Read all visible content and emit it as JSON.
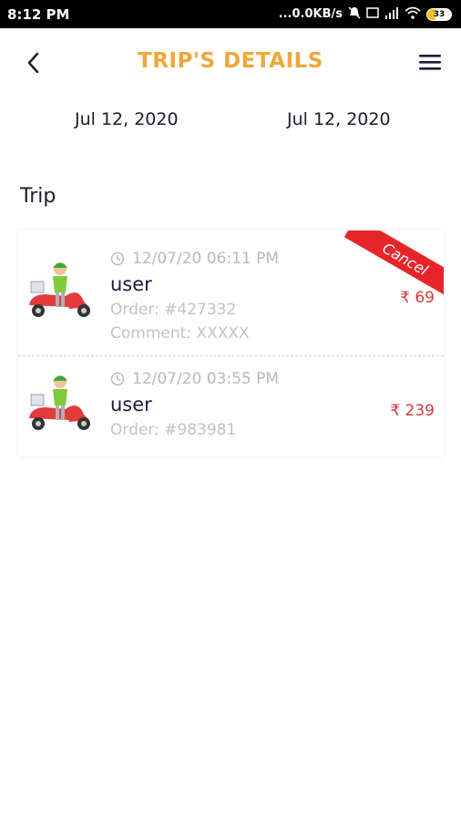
{
  "status_bar": {
    "time": "8:12 PM",
    "network_speed": "...0.0KB/s",
    "battery": "33"
  },
  "header": {
    "title": "TRIP'S DETAILS"
  },
  "date_range": {
    "from": "Jul 12, 2020",
    "to": "Jul 12, 2020"
  },
  "section_title": "Trip",
  "colors": {
    "accent": "#f0a73a",
    "price": "#d9393b",
    "ribbon": "#e8242b",
    "text_dark": "#1c1c3c"
  },
  "trips": [
    {
      "datetime": "12/07/20 06:11 PM",
      "user": "user",
      "order": "Order: #427332",
      "comment": "Comment: XXXXX",
      "price": "₹ 69",
      "status_ribbon": "Cancel"
    },
    {
      "datetime": "12/07/20 03:55 PM",
      "user": "user",
      "order": "Order: #983981",
      "price": "₹ 239"
    }
  ]
}
